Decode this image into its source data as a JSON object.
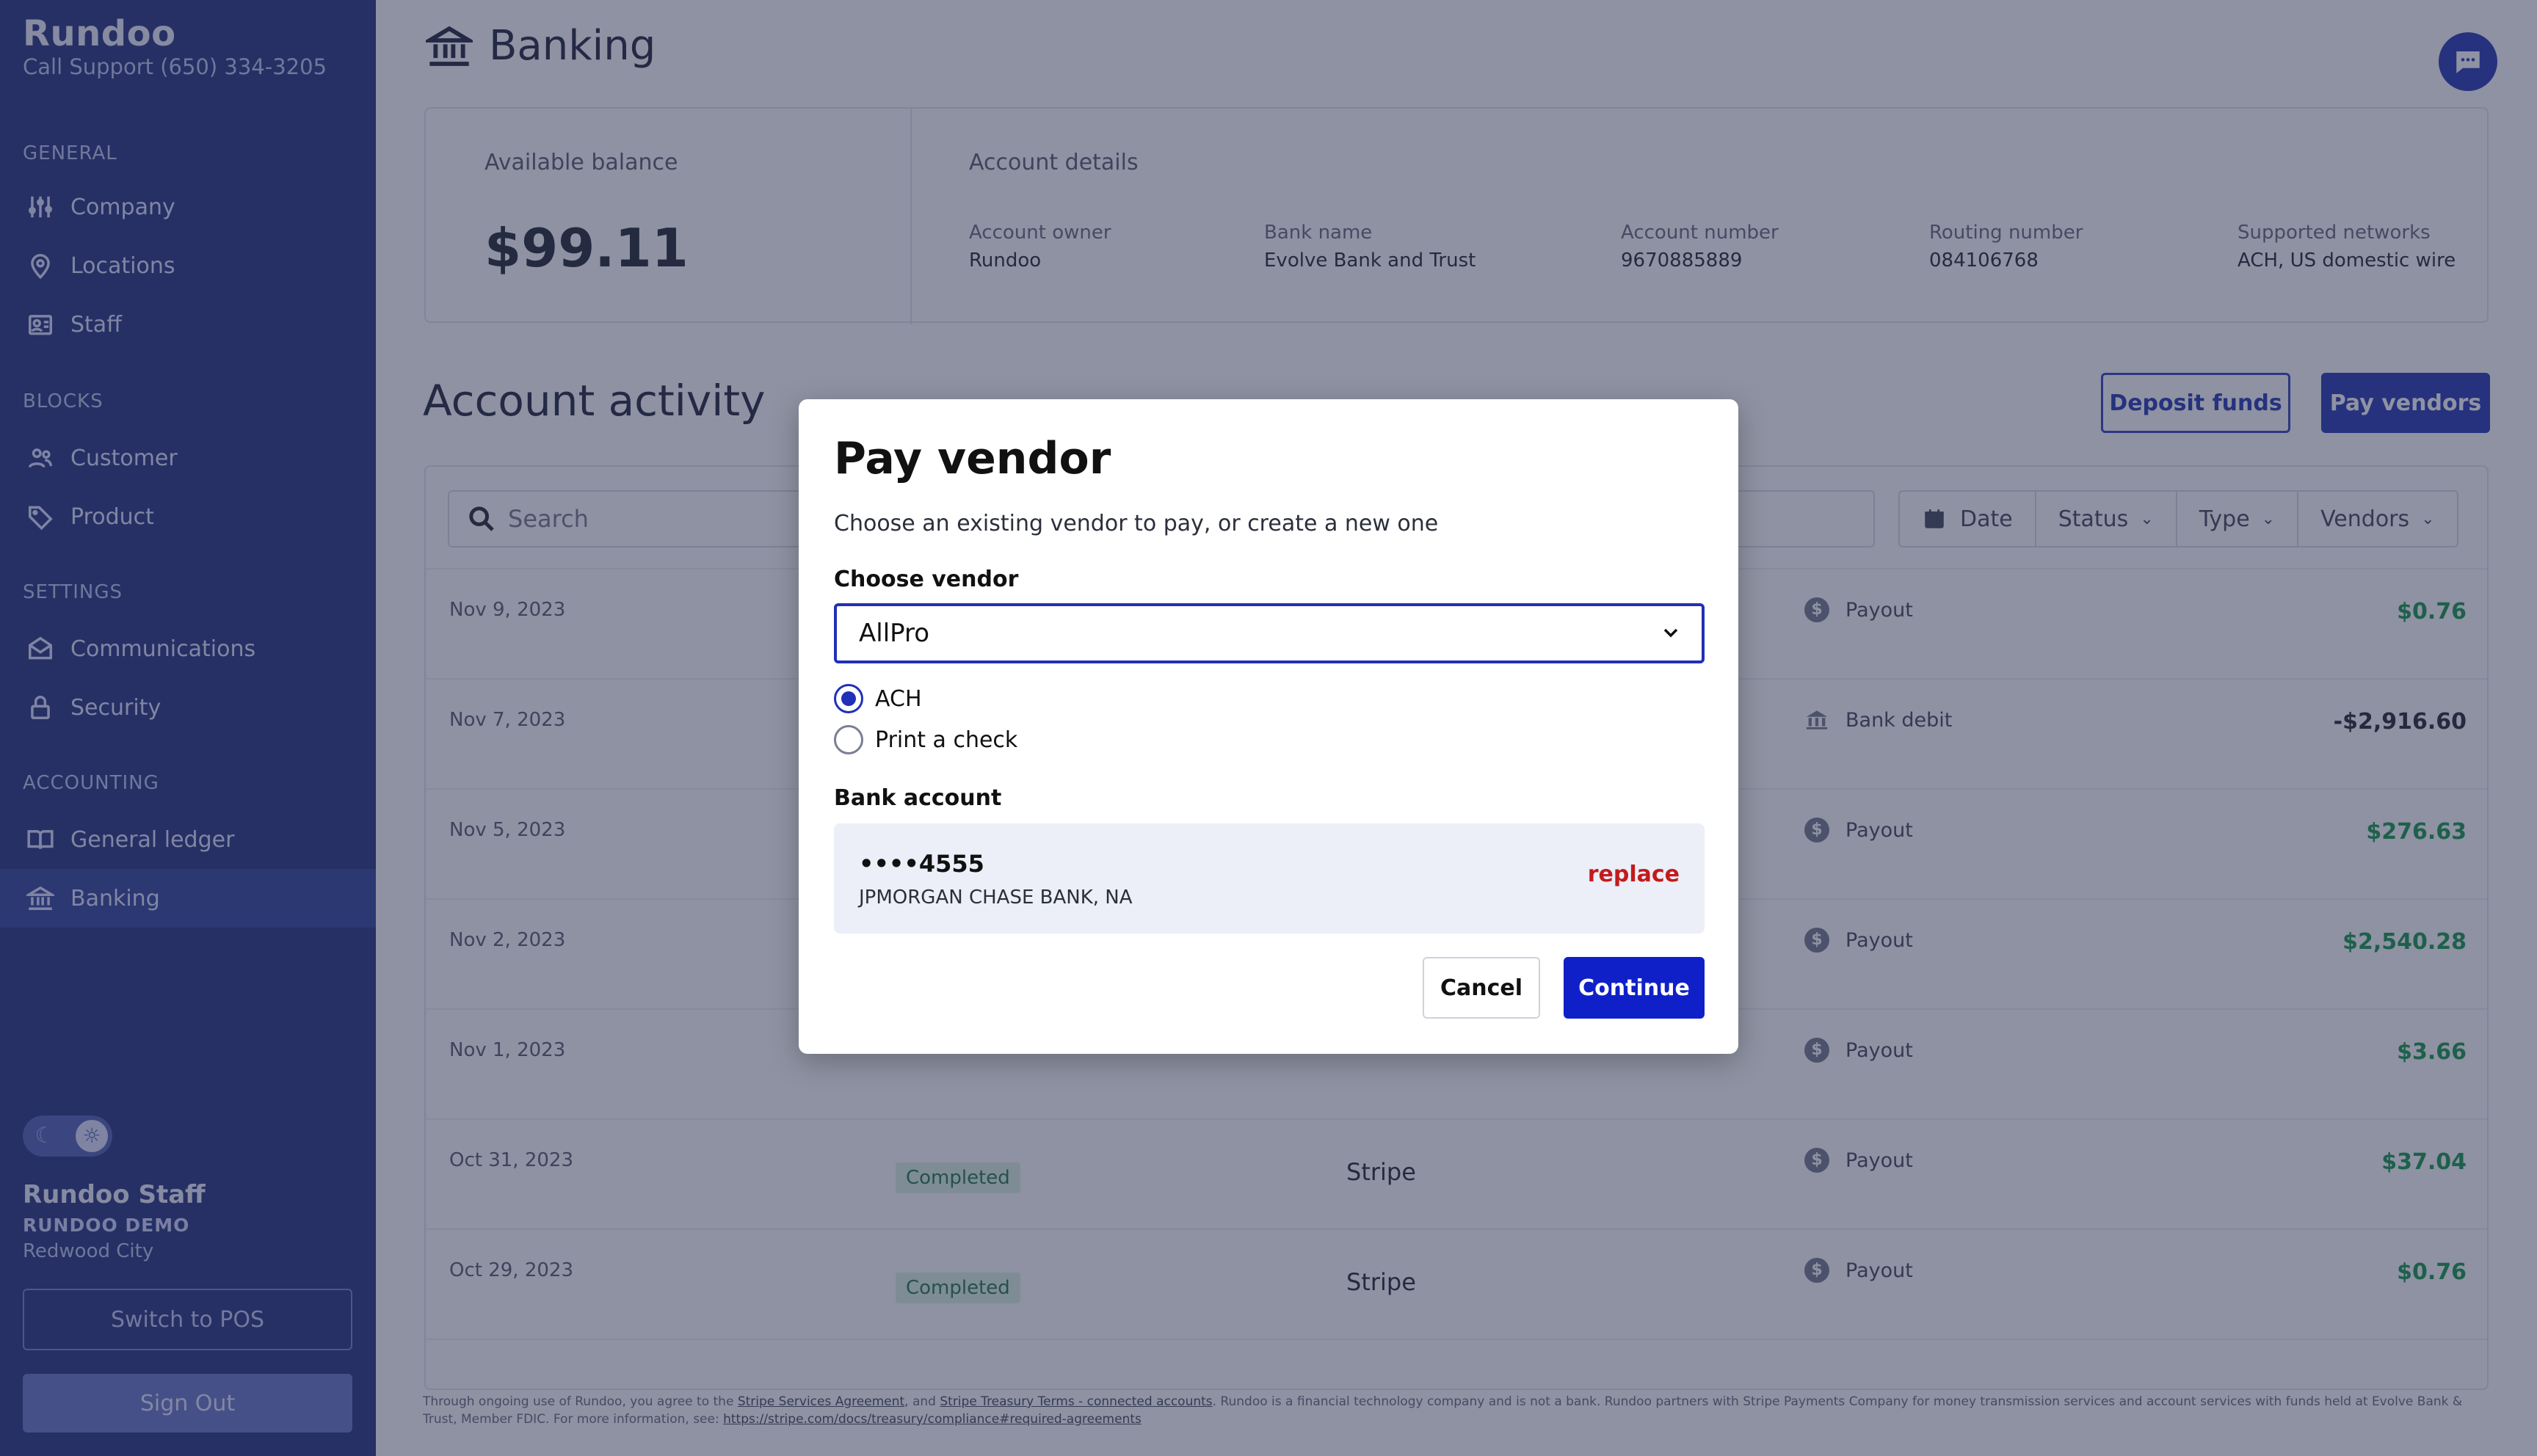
{
  "sidebar": {
    "brand": "Rundoo",
    "support": "Call Support (650) 334-3205",
    "sections": {
      "general": "GENERAL",
      "blocks": "BLOCKS",
      "settings": "SETTINGS",
      "accounting": "ACCOUNTING"
    },
    "items": [
      {
        "label": "Company",
        "icon": "sliders-icon"
      },
      {
        "label": "Locations",
        "icon": "map-pin-icon"
      },
      {
        "label": "Staff",
        "icon": "id-badge-icon"
      },
      {
        "label": "Customer",
        "icon": "users-icon"
      },
      {
        "label": "Product",
        "icon": "tag-icon"
      },
      {
        "label": "Communications",
        "icon": "mail-icon"
      },
      {
        "label": "Security",
        "icon": "lock-icon"
      },
      {
        "label": "General ledger",
        "icon": "book-icon"
      },
      {
        "label": "Banking",
        "icon": "bank-icon",
        "active": true
      }
    ],
    "user": {
      "name": "Rundoo Staff",
      "org": "RUNDOO DEMO",
      "city": "Redwood City"
    },
    "switch_label": "Switch to POS",
    "signout_label": "Sign Out"
  },
  "header": {
    "title": "Banking"
  },
  "balance": {
    "label": "Available balance",
    "value": "$99.11"
  },
  "account": {
    "label": "Account details",
    "details": [
      {
        "key": "Account owner",
        "value": "Rundoo"
      },
      {
        "key": "Bank name",
        "value": "Evolve Bank and Trust"
      },
      {
        "key": "Account number",
        "value": "9670885889"
      },
      {
        "key": "Routing number",
        "value": "084106768"
      },
      {
        "key": "Supported networks",
        "value": "ACH, US domestic wire"
      }
    ]
  },
  "activity": {
    "title": "Account activity",
    "deposit_label": "Deposit funds",
    "pay_label": "Pay vendors",
    "search_placeholder": "Search",
    "filters": [
      "Date",
      "Status",
      "Type",
      "Vendors"
    ],
    "rows": [
      {
        "date": "Nov 9, 2023",
        "status": "",
        "source": "",
        "type": "Payout",
        "amount": "$0.76",
        "sign": "pos"
      },
      {
        "date": "Nov 7, 2023",
        "status": "",
        "source": "",
        "type": "Bank debit",
        "amount": "-$2,916.60",
        "sign": "neg"
      },
      {
        "date": "Nov 5, 2023",
        "status": "",
        "source": "",
        "type": "Payout",
        "amount": "$276.63",
        "sign": "pos"
      },
      {
        "date": "Nov 2, 2023",
        "status": "",
        "source": "",
        "type": "Payout",
        "amount": "$2,540.28",
        "sign": "pos"
      },
      {
        "date": "Nov 1, 2023",
        "status": "",
        "source": "",
        "type": "Payout",
        "amount": "$3.66",
        "sign": "pos"
      },
      {
        "date": "Oct 31, 2023",
        "status": "Completed",
        "source": "Stripe",
        "type": "Payout",
        "amount": "$37.04",
        "sign": "pos"
      },
      {
        "date": "Oct 29, 2023",
        "status": "Completed",
        "source": "Stripe",
        "type": "Payout",
        "amount": "$0.76",
        "sign": "pos"
      }
    ]
  },
  "footer": {
    "text1": "Through ongoing use of Rundoo, you agree to the ",
    "link1": "Stripe Services Agreement",
    "text2": ", and ",
    "link2": "Stripe Treasury Terms - connected accounts",
    "text3": ". Rundoo is a financial technology company and is not a bank. Rundoo partners with Stripe Payments Company for money transmission services and account services with funds held at Evolve Bank & Trust, Member FDIC. For more information, see: ",
    "link3": "https://stripe.com/docs/treasury/compliance#required-agreements"
  },
  "modal": {
    "title": "Pay vendor",
    "subtitle": "Choose an existing vendor to pay, or create a new one",
    "vendor_label": "Choose vendor",
    "vendor_value": "AllPro",
    "method_ach": "ACH",
    "method_check": "Print a check",
    "selected_method": "ACH",
    "bank_label": "Bank account",
    "bank_number": "••••4555",
    "bank_name": "JPMORGAN CHASE BANK, NA",
    "replace_label": "replace",
    "cancel_label": "Cancel",
    "continue_label": "Continue"
  },
  "colors": {
    "brand": "#2f3fb4",
    "primary_button": "#1020c8",
    "positive": "#1f9a52",
    "danger": "#c21b1b"
  }
}
